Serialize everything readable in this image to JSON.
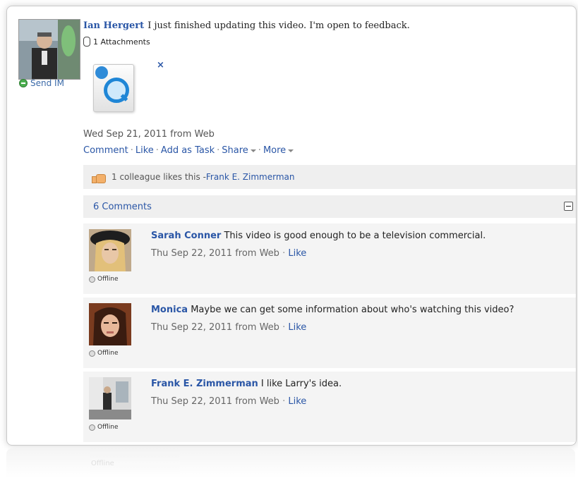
{
  "post": {
    "author": "Ian Hergert",
    "text": "I just finished updating this video. I'm open to feedback.",
    "attachments_label": "1 Attachments",
    "remove_label": "×",
    "send_im": "Send IM",
    "date": "Wed Sep 21, 2011",
    "source": "from Web",
    "actions": [
      "Comment",
      "Like",
      "Add as Task",
      "Share",
      "More"
    ]
  },
  "likes": {
    "text": "1 colleague likes this - ",
    "liker": "Frank E. Zimmerman"
  },
  "comments_header": {
    "label": "6 Comments"
  },
  "comments": [
    {
      "author": "Sarah Conner",
      "text": "This video is good enough to be a television commercial.",
      "date": "Thu Sep 22, 2011 from Web",
      "like": "Like",
      "status": "Offline"
    },
    {
      "author": "Monica",
      "text": "Maybe we can get some information about who's watching this video?",
      "date": "Thu Sep 22, 2011 from Web",
      "like": "Like",
      "status": "Offline"
    },
    {
      "author": "Frank E. Zimmerman",
      "text": "I like Larry's idea.",
      "date": "Thu Sep 22, 2011 from Web",
      "like": "Like",
      "status": "Offline"
    }
  ],
  "reflection_text": "Offline"
}
